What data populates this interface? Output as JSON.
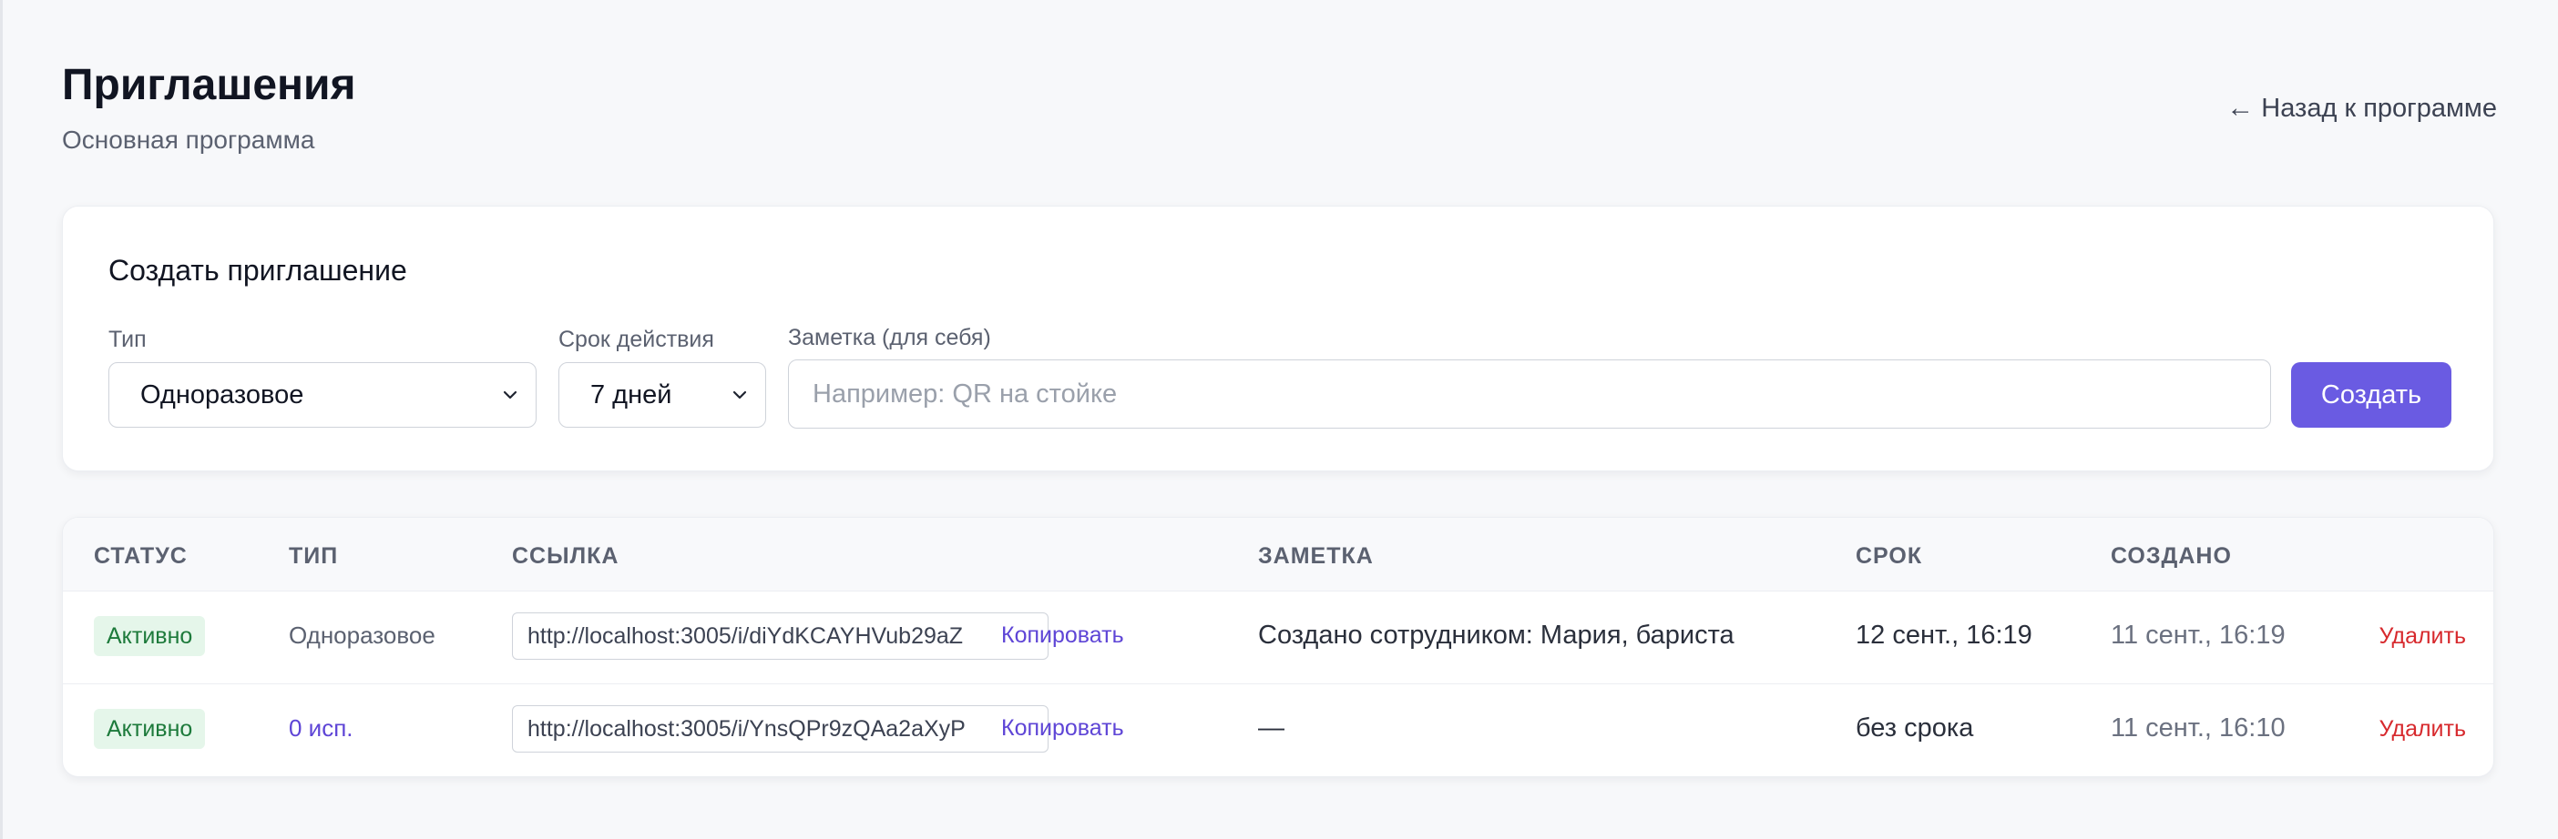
{
  "header": {
    "title": "Приглашения",
    "subtitle": "Основная программа",
    "back_label": "Назад к программе",
    "back_icon": "arrow-left-icon"
  },
  "create_form": {
    "title": "Создать приглашение",
    "type": {
      "label": "Тип",
      "value": "Одноразовое"
    },
    "expiry": {
      "label": "Срок действия",
      "value": "7 дней"
    },
    "note": {
      "label": "Заметка (для себя)",
      "value": "",
      "placeholder": "Например: QR на стойке"
    },
    "submit_label": "Создать"
  },
  "table": {
    "columns": {
      "status": "СТАТУС",
      "type": "ТИП",
      "link": "ССЫЛКА",
      "note": "ЗАМЕТКА",
      "expires": "СРОК",
      "created": "СОЗДАНО"
    },
    "rows": [
      {
        "status": "Активно",
        "type": "Одноразовое",
        "link": "http://localhost:3005/i/diYdKCAYHVub29aZ",
        "copy_label": "Копировать",
        "note": "Создано сотрудником: Мария, бариста",
        "expires": "12 сент., 16:19",
        "created": "11 сент., 16:19",
        "delete_label": "Удалить"
      },
      {
        "status": "Активно",
        "type": "0 исп.",
        "link": "http://localhost:3005/i/YnsQPr9zQAa2aXyP",
        "copy_label": "Копировать",
        "note": "—",
        "expires": "без срока",
        "created": "11 сент., 16:10",
        "delete_label": "Удалить"
      }
    ]
  },
  "colors": {
    "accent": "#6a5be2",
    "link": "#5e45d6",
    "status_active_bg": "#e5f6ea",
    "status_active_text": "#1d7a3b",
    "danger": "#d7292d",
    "background": "#f7f8fa"
  }
}
